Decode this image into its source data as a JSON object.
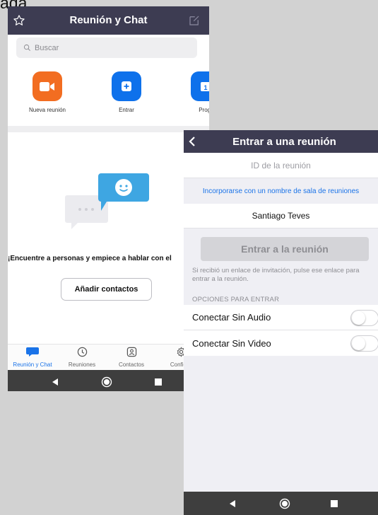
{
  "corner_text": "ada",
  "left_app": {
    "title": "Reunión y Chat",
    "search": {
      "placeholder": "Buscar"
    },
    "quick_actions": [
      {
        "label": "Nueva reunión",
        "icon": "video-camera-icon",
        "color": "#f26d21"
      },
      {
        "label": "Entrar",
        "icon": "plus-icon",
        "color": "#0e71eb"
      },
      {
        "label": "Programar",
        "label_visible": "Progr",
        "icon": "calendar-icon",
        "color": "#0e71eb"
      }
    ],
    "empty_state": {
      "message": "¡Encuentre a personas y empiece a hablar con el",
      "add_button": "Añadir contactos"
    },
    "tabs": [
      {
        "label": "Reunión y Chat",
        "icon": "chat-bubble-icon",
        "active": true
      },
      {
        "label": "Reuniones",
        "icon": "clock-icon",
        "active": false
      },
      {
        "label": "Contactos",
        "icon": "contacts-icon",
        "active": false
      },
      {
        "label": "Configur",
        "icon": "gear-icon",
        "active": false
      }
    ]
  },
  "right_app": {
    "title": "Entrar a una reunión",
    "meeting_id_placeholder": "ID de la reunión",
    "room_link": "Incorporarse con un nombre de sala de reuniones",
    "name_value": "Santiago Teves",
    "join_button": "Entrar a la reunión",
    "hint": "Si recibió un enlace de invitación, pulse ese enlace para entrar a la reunión.",
    "options_header": "OPCIONES PARA ENTRAR",
    "options": [
      {
        "label": "Conectar Sin Audio",
        "enabled": false
      },
      {
        "label": "Conectar Sin Video",
        "enabled": false
      }
    ]
  },
  "colors": {
    "header_bg": "#3d3c52",
    "accent": "#0e71eb",
    "orange": "#f26d21",
    "link": "#1a73e8",
    "nav_bar": "#3e3e3e"
  }
}
